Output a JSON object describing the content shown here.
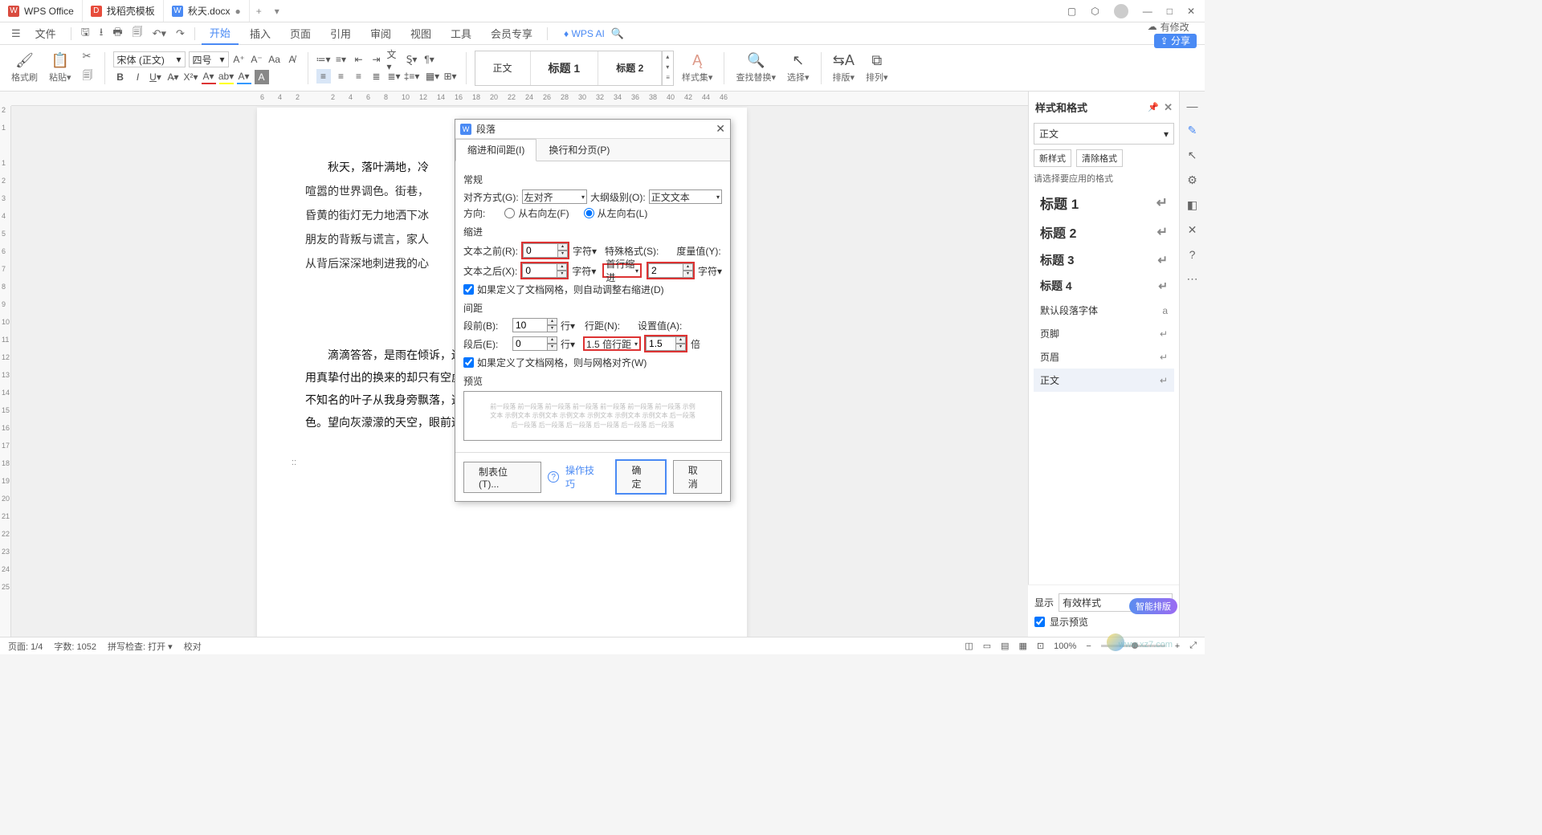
{
  "titlebar": {
    "tabs": [
      {
        "icon": "W",
        "label": "WPS Office"
      },
      {
        "icon": "D",
        "label": "找稻壳模板"
      },
      {
        "icon": "W",
        "label": "秋天.docx",
        "modified": "●"
      }
    ],
    "add": "+"
  },
  "menubar": {
    "hamburger": "☰",
    "file": "文件",
    "items": [
      "开始",
      "插入",
      "页面",
      "引用",
      "审阅",
      "视图",
      "工具",
      "会员专享"
    ],
    "active": "开始",
    "ai": "WPS AI",
    "modified_notice": "有修改",
    "share": "分享"
  },
  "ribbon": {
    "format_painter": "格式刷",
    "paste": "粘贴",
    "font_name": "宋体 (正文)",
    "font_size": "四号",
    "styles_label": "样式集",
    "find_replace": "查找替换",
    "select": "选择",
    "layout_label": "排版",
    "arrange": "排列",
    "gallery": {
      "body": "正文",
      "h1": "标题 1",
      "h2": "标题 2"
    }
  },
  "ruler": {
    "h_ticks": [
      "6",
      "4",
      "2",
      "",
      "2",
      "4",
      "6",
      "8",
      "10",
      "12",
      "14",
      "16",
      "18",
      "20",
      "22",
      "24",
      "26",
      "28",
      "30",
      "32",
      "34",
      "36",
      "38",
      "40",
      "42",
      "44",
      "46"
    ]
  },
  "document": {
    "para1": "秋天，落叶满地，冷",
    "para1b": "喧嚣的世界调色。街巷，",
    "para1c": "昏黄的街灯无力地洒下冰",
    "para1d": "朋友的背叛与谎言，家人",
    "para1e": "从背后深深地刺进我的心",
    "para2": "滴滴答答，是雨在倾诉，还是它在流血。一片黯然了眼眸，为什么我用真挚付出的换来的却只有空虚和冷漠？任秋雨洒在我身上，任枯黄而又不知名的叶子从我身旁飘落，这世界好似只有那一种颜色——冰冷的灰色。望向灰濛濛的天空，眼前逐渐泪眼朦胧。"
  },
  "dialog": {
    "title": "段落",
    "tabs": {
      "indent": "缩进和间距(I)",
      "page": "换行和分页(P)"
    },
    "section_general": "常规",
    "align_label": "对齐方式(G):",
    "align_value": "左对齐",
    "outline_label": "大纲级别(O):",
    "outline_value": "正文文本",
    "direction_label": "方向:",
    "dir_rtl": "从右向左(F)",
    "dir_ltr": "从左向右(L)",
    "section_indent": "缩进",
    "text_before_label": "文本之前(R):",
    "text_before_value": "0",
    "text_after_label": "文本之后(X):",
    "text_after_value": "0",
    "unit_char": "字符",
    "special_label": "特殊格式(S):",
    "special_value": "首行缩进",
    "metric_label": "度量值(Y):",
    "metric_value": "2",
    "auto_indent_check": "如果定义了文档网格，则自动调整右缩进(D)",
    "section_spacing": "间距",
    "space_before_label": "段前(B):",
    "space_before_value": "10",
    "space_after_label": "段后(E):",
    "space_after_value": "0",
    "unit_line": "行",
    "line_spacing_label": "行距(N):",
    "line_spacing_value": "1.5 倍行距",
    "set_value_label": "设置值(A):",
    "set_value": "1.5",
    "unit_times": "倍",
    "snap_grid_check": "如果定义了文档网格，则与网格对齐(W)",
    "section_preview": "预览",
    "preview_placeholder": "前一段落 前一段落 前一段落 前一段落 前一段落 前一段落 前一段落\n示例文本 示例文本 示例文本 示例文本 示例文本 示例文本 示例文本\n后一段落 后一段落 后一段落 后一段落 后一段落 后一段落 后一段落",
    "tabstops_btn": "制表位(T)...",
    "tips_link": "操作技巧",
    "ok": "确定",
    "cancel": "取消"
  },
  "right_panel": {
    "title": "样式和格式",
    "current_style": "正文",
    "new_style": "新样式",
    "clear_format": "清除格式",
    "hint": "请选择要应用的格式",
    "styles": [
      {
        "label": "标题 1",
        "cls": "h1"
      },
      {
        "label": "标题 2",
        "cls": "h2"
      },
      {
        "label": "标题 3",
        "cls": "h3"
      },
      {
        "label": "标题 4",
        "cls": "h4"
      },
      {
        "label": "默认段落字体",
        "cls": "norm",
        "icon": "a"
      },
      {
        "label": "页脚",
        "cls": "norm"
      },
      {
        "label": "页眉",
        "cls": "norm"
      },
      {
        "label": "正文",
        "cls": "norm",
        "selected": true
      }
    ],
    "show_label": "显示",
    "show_value": "有效样式",
    "preview_check": "显示预览",
    "smart_badge": "智能排版"
  },
  "statusbar": {
    "page": "页面: 1/4",
    "words": "字数: 1052",
    "spell": "拼写检查: 打开",
    "proof": "校对",
    "zoom": "100%"
  },
  "watermark": "www.xz7.com"
}
